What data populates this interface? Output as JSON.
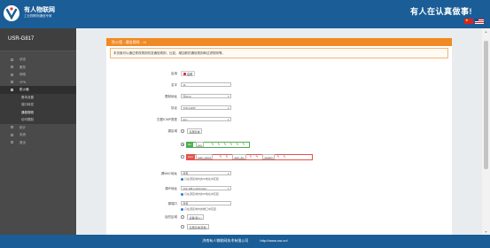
{
  "header": {
    "logo_icon": "usr-logo-icon",
    "brand_title": "有人物联网",
    "brand_subtitle": "工业物联网通信专家",
    "slogan": "有人在认真做事!",
    "languages": [
      "中文",
      "English"
    ]
  },
  "sidebar": {
    "device": "USR-G817",
    "items": [
      {
        "label": "状态",
        "icon": "status-icon"
      },
      {
        "label": "服务",
        "icon": "service-icon"
      },
      {
        "label": "网络",
        "icon": "network-icon"
      },
      {
        "label": "VPN",
        "icon": "vpn-icon"
      },
      {
        "label": "防火墙",
        "icon": "firewall-icon",
        "active": true
      },
      {
        "label": "统计",
        "icon": "stats-icon"
      },
      {
        "label": "系统",
        "icon": "system-icon"
      },
      {
        "label": "退出",
        "icon": "logout-icon"
      }
    ],
    "subitems": [
      {
        "label": "基本设置"
      },
      {
        "label": "端口转发"
      },
      {
        "label": "通信规则",
        "current": true
      },
      {
        "label": "访问限制"
      }
    ]
  },
  "panel": {
    "title": "防火墙 - 通信规则 - 11",
    "description": "本页面可以通过修改规则改变通信规则，比如，增加新的通信规则和过滤规则等。",
    "fields": {
      "enable": {
        "label": "启用",
        "value": "启用"
      },
      "name": {
        "label": "名字",
        "value": "11"
      },
      "family": {
        "label": "限制地址",
        "value": "仅IPv4"
      },
      "protocol": {
        "label": "协议",
        "value": "TCP+UDP"
      },
      "icmp": {
        "label": "匹配ICMP类型",
        "value": "any"
      },
      "source_zone": {
        "label": "源区域",
        "any_label": "任意区域",
        "lan_tag": "lan:",
        "lan_chip": "lan",
        "wan_tag": "wan:",
        "wan_chips": [
          "wan_wired",
          "wan_4g",
          "wwan1"
        ]
      },
      "source_mac": {
        "label": "源MAC地址",
        "value": "所有",
        "hint": "只在源区域内的IP地址中匹配"
      },
      "source_ip": {
        "label": "源IP地址",
        "value": "192.168.1.0/24 (lan)",
        "hint": "只在源区域内的IP地址中匹配"
      },
      "source_port": {
        "label": "源端口",
        "value": "所有",
        "hint": "只在源区域内的端口中匹配"
      },
      "dest_zone": {
        "label": "目的区域",
        "device_label": "设备(输入)",
        "any_label": "任意区域(转发)"
      }
    }
  },
  "footer": {
    "company": "济南有人物联网技术有限公司",
    "url": "http://www.usr.cn/"
  }
}
